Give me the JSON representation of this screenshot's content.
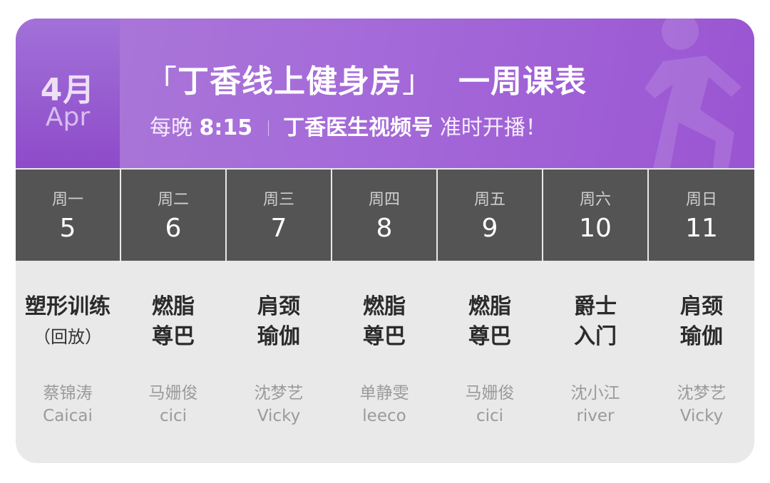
{
  "header": {
    "month_number": "4月",
    "month_english": "Apr",
    "title_open_bracket": "「",
    "title_main": "丁香线上健身房",
    "title_close_bracket": "」",
    "title_suffix": "一周课表",
    "subtitle_prefix": "每晚",
    "subtitle_time": "8:15",
    "subtitle_channel": "丁香医生视频号",
    "subtitle_suffix": "准时开播！"
  },
  "colors": {
    "header_purple": "#a56bd9",
    "month_box_purple": "#8e4bc9",
    "day_header_bg": "#545454",
    "class_bg": "#e9e9e9"
  },
  "schedule": [
    {
      "weekday": "周一",
      "date": "5",
      "class_line1": "塑形训练",
      "class_line2": "",
      "note": "（回放）",
      "teacher_cn": "蔡锦涛",
      "teacher_en": "Caicai"
    },
    {
      "weekday": "周二",
      "date": "6",
      "class_line1": "燃脂",
      "class_line2": "尊巴",
      "note": "",
      "teacher_cn": "马姗俊",
      "teacher_en": "cici"
    },
    {
      "weekday": "周三",
      "date": "7",
      "class_line1": "肩颈",
      "class_line2": "瑜伽",
      "note": "",
      "teacher_cn": "沈梦艺",
      "teacher_en": "Vicky"
    },
    {
      "weekday": "周四",
      "date": "8",
      "class_line1": "燃脂",
      "class_line2": "尊巴",
      "note": "",
      "teacher_cn": "单静雯",
      "teacher_en": "leeco"
    },
    {
      "weekday": "周五",
      "date": "9",
      "class_line1": "燃脂",
      "class_line2": "尊巴",
      "note": "",
      "teacher_cn": "马姗俊",
      "teacher_en": "cici"
    },
    {
      "weekday": "周六",
      "date": "10",
      "class_line1": "爵士",
      "class_line2": "入门",
      "note": "",
      "teacher_cn": "沈小江",
      "teacher_en": "river"
    },
    {
      "weekday": "周日",
      "date": "11",
      "class_line1": "肩颈",
      "class_line2": "瑜伽",
      "note": "",
      "teacher_cn": "沈梦艺",
      "teacher_en": "Vicky"
    }
  ]
}
